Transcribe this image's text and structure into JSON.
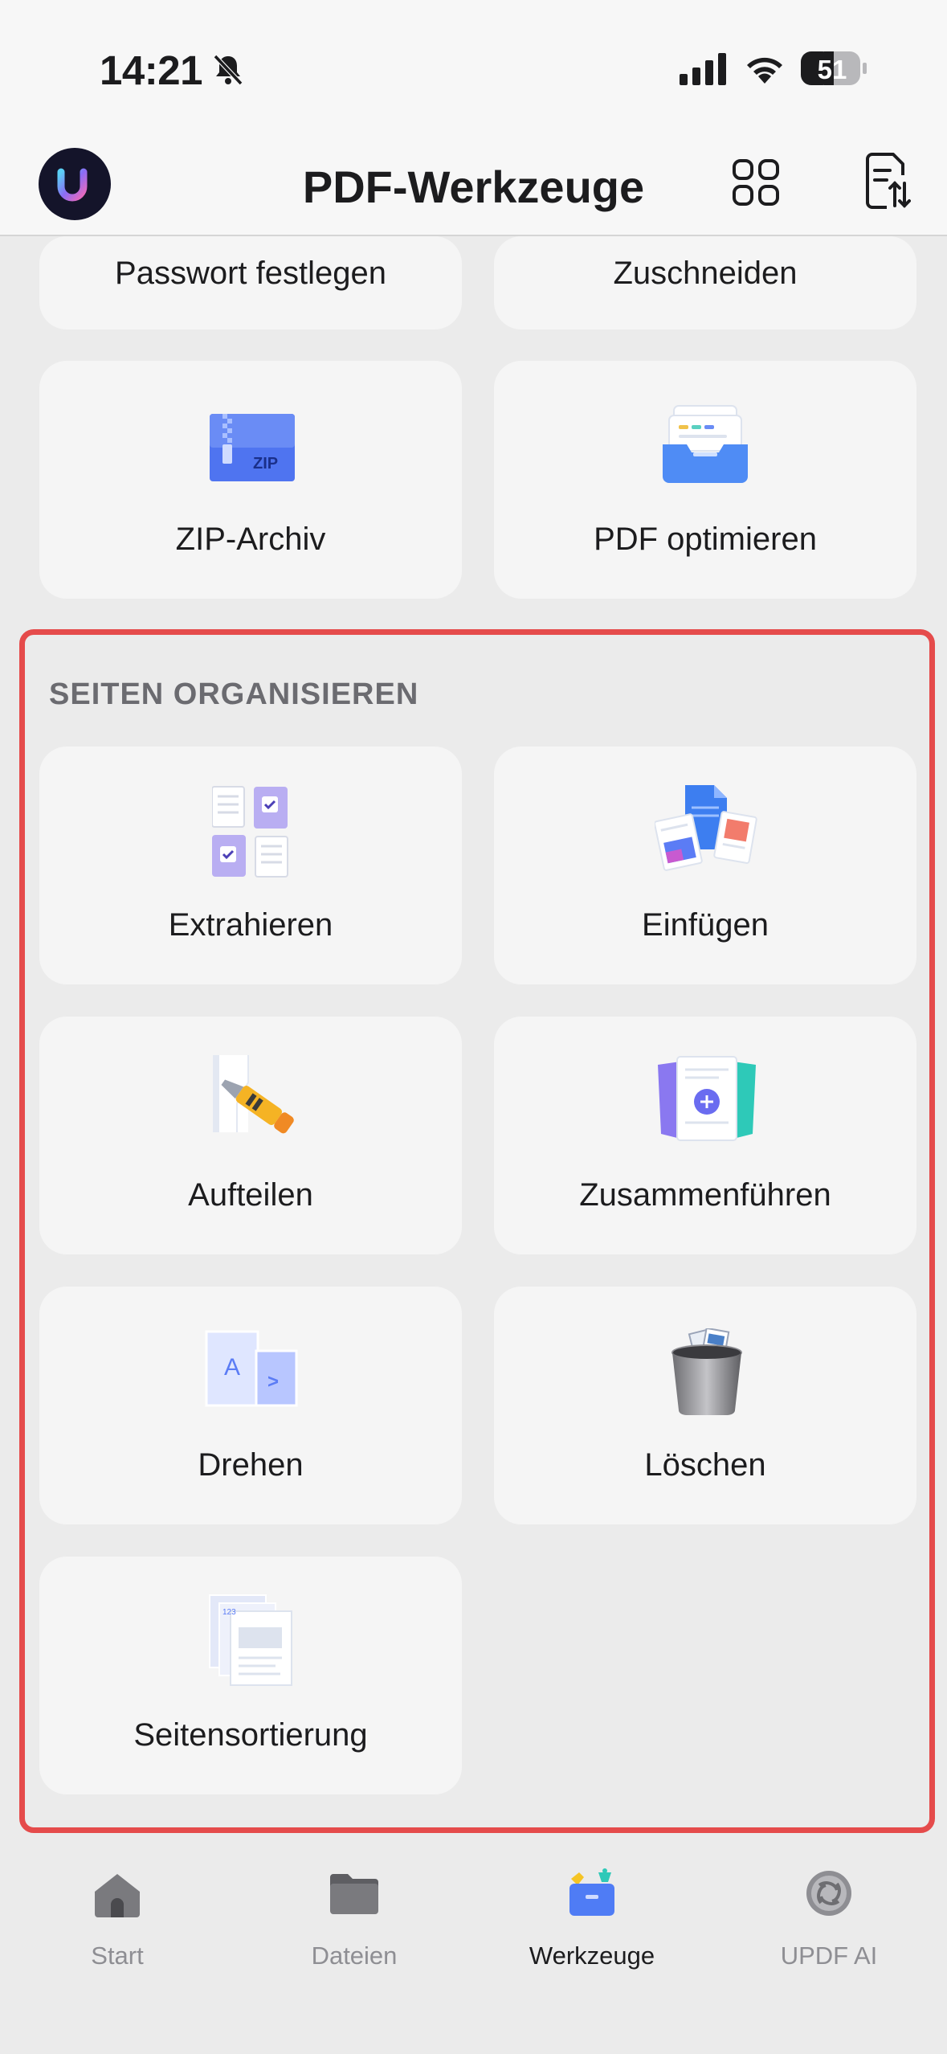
{
  "status_bar": {
    "time": "14:21",
    "battery": "51",
    "icons": [
      "bell-slash-icon",
      "cellular-signal-icon",
      "wifi-icon",
      "battery-icon"
    ]
  },
  "header": {
    "title": "PDF-Werkzeuge",
    "logo_icon": "updf-logo-icon",
    "actions": [
      "grid-view-icon",
      "document-sort-icon"
    ]
  },
  "tools_top": [
    {
      "label": "Passwort festlegen"
    },
    {
      "label": "Zuschneiden"
    },
    {
      "label": "ZIP-Archiv",
      "icon": "zip-archive-icon"
    },
    {
      "label": "PDF optimieren",
      "icon": "optimize-tray-icon"
    }
  ],
  "organize": {
    "title": "SEITEN ORGANISIEREN",
    "items": [
      {
        "label": "Extrahieren",
        "icon": "extract-pages-icon"
      },
      {
        "label": "Einfügen",
        "icon": "insert-pages-icon"
      },
      {
        "label": "Aufteilen",
        "icon": "split-cutter-icon"
      },
      {
        "label": "Zusammenführen",
        "icon": "merge-pages-icon"
      },
      {
        "label": "Drehen",
        "icon": "rotate-pages-icon"
      },
      {
        "label": "Löschen",
        "icon": "trash-bin-icon"
      },
      {
        "label": "Seitensortierung",
        "icon": "page-order-icon"
      }
    ]
  },
  "tabbar": {
    "tabs": [
      {
        "label": "Start",
        "icon": "home-icon",
        "active": false
      },
      {
        "label": "Dateien",
        "icon": "folder-icon",
        "active": false
      },
      {
        "label": "Werkzeuge",
        "icon": "tools-icon",
        "active": true
      },
      {
        "label": "UPDF AI",
        "icon": "ai-icon",
        "active": false
      }
    ]
  },
  "colors": {
    "background": "#ebebeb",
    "card": "#f5f5f5",
    "highlight": "#e54b4b",
    "accent": "#5b7cf5"
  }
}
